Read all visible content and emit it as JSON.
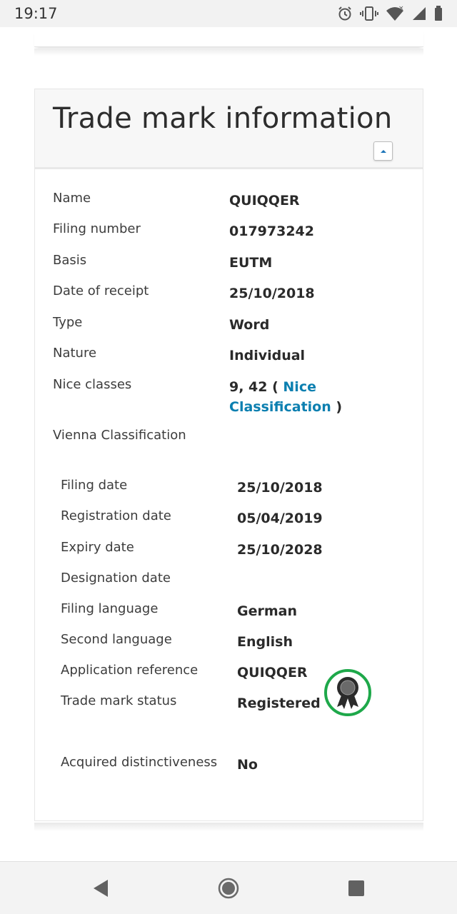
{
  "status_bar": {
    "time": "19:17",
    "icons": [
      "alarm-icon",
      "vibrate-icon",
      "wifi-icon",
      "signal-icon",
      "battery-icon"
    ]
  },
  "card": {
    "title": "Trade mark information",
    "collapse_icon": "caret-up-icon"
  },
  "fields": [
    {
      "label": "Name",
      "value": "QUIQQER"
    },
    {
      "label": "Filing number",
      "value": "017973242"
    },
    {
      "label": "Basis",
      "value": "EUTM"
    },
    {
      "label": "Date of receipt",
      "value": "25/10/2018"
    },
    {
      "label": "Type",
      "value": "Word"
    },
    {
      "label": "Nature",
      "value": "Individual"
    },
    {
      "label": "Nice classes",
      "value_prefix": "9, 42 ( ",
      "link_text": "Nice Classification",
      "value_suffix": " )"
    },
    {
      "label": "Vienna Classification",
      "value": ""
    }
  ],
  "sub_fields": [
    {
      "label": "Filing date",
      "value": "25/10/2018"
    },
    {
      "label": "Registration date",
      "value": "05/04/2019"
    },
    {
      "label": "Expiry date",
      "value": "25/10/2028"
    },
    {
      "label": "Designation date",
      "value": ""
    },
    {
      "label": "Filing language",
      "value": "German"
    },
    {
      "label": "Second language",
      "value": "English"
    },
    {
      "label": "Application reference",
      "value": "QUIQQER"
    },
    {
      "label": "Trade mark status",
      "value": "Registered",
      "badge_icon": "award-ribbon-icon"
    },
    {
      "label": "Acquired distinctiveness",
      "value": "No"
    }
  ],
  "colors": {
    "link": "#0b7fb0",
    "badge_ring": "#1ea84a"
  },
  "nav_bar": {
    "icons": [
      "back-icon",
      "home-icon",
      "recents-icon"
    ]
  }
}
